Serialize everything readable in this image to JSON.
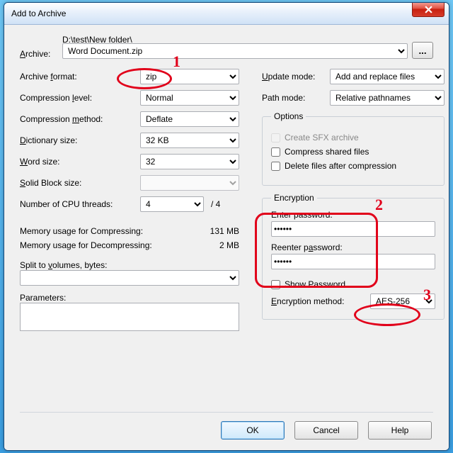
{
  "title": "Add to Archive",
  "archive": {
    "label": "Archive:",
    "underline_char": "A",
    "path_dir": "D:\\test\\New folder\\",
    "filename": "Word Document.zip",
    "browse": "..."
  },
  "left": {
    "format": {
      "label_prefix": "Archive ",
      "u": "f",
      "label_rest": "ormat:",
      "value": "zip"
    },
    "level": {
      "label_prefix": "Compression ",
      "u": "l",
      "label_rest": "evel:",
      "value": "Normal"
    },
    "method": {
      "label_prefix": "Compression ",
      "u": "m",
      "label_rest": "ethod:",
      "value": "Deflate"
    },
    "dict": {
      "u": "D",
      "label_rest": "ictionary size:",
      "value": "32 KB"
    },
    "word": {
      "u": "W",
      "label_rest": "ord size:",
      "value": "32"
    },
    "solid": {
      "u": "S",
      "label_rest": "olid Block size:",
      "value": ""
    },
    "cpu": {
      "label": "Number of CPU threads:",
      "value": "4",
      "total": "/ 4"
    },
    "mem_comp": {
      "label": "Memory usage for Compressing:",
      "value": "131 MB"
    },
    "mem_decomp": {
      "label": "Memory usage for Decompressing:",
      "value": "2 MB"
    },
    "split": {
      "label_prefix": "Split to ",
      "u": "v",
      "label_rest": "olumes, bytes:",
      "value": ""
    },
    "params": {
      "label": "Parameters:",
      "value": ""
    }
  },
  "right": {
    "update": {
      "u": "U",
      "label_rest": "pdate mode:",
      "value": "Add and replace files"
    },
    "pathmode": {
      "label": "Path mode:",
      "value": "Relative pathnames"
    },
    "options": {
      "legend": "Options",
      "sfx": {
        "label": "Create SFX archive",
        "checked": false,
        "disabled": true
      },
      "shared": {
        "label": "Compress shared files",
        "checked": false
      },
      "del": {
        "label": "Delete files after compression",
        "checked": false
      }
    },
    "encryption": {
      "legend": "Encryption",
      "enter": {
        "label": "Enter password:",
        "value": "••••••"
      },
      "reenter": {
        "label_prefix": "Reenter p",
        "u": "a",
        "label_rest": "ssword:",
        "value": "••••••"
      },
      "show": {
        "label": "Show Password",
        "checked": false
      },
      "method": {
        "u": "E",
        "label_rest": "ncryption method:",
        "value": "AES-256"
      }
    }
  },
  "buttons": {
    "ok": "OK",
    "cancel": "Cancel",
    "help": "Help"
  },
  "annotations": {
    "a1": "1",
    "a2": "2",
    "a3": "3"
  }
}
